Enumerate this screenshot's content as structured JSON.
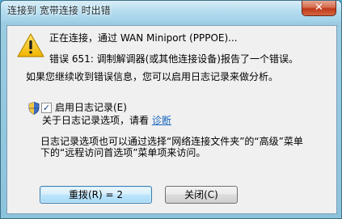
{
  "window": {
    "title": "连接到 宽带连接 时出错",
    "close_glyph": "✕"
  },
  "message": {
    "connecting": "正在连接，通过 WAN Miniport (PPPOE)...",
    "error": "错误 651: 调制解调器(或其他连接设备)报告了一个错误。",
    "hint": "如果您继续收到错误信息，您可以启用日志记录来做分析。"
  },
  "logging": {
    "enable_label": "启用日志记录(E)",
    "checked": true,
    "check_glyph": "✓",
    "about_prefix": "关于日志记录选项，请看",
    "about_link": "诊断",
    "desc_line1": "日志记录选项也可以通过选择“网络连接文件夹”的“高级”菜单",
    "desc_line2": "下的“远程访问首选项”菜单项来访问。"
  },
  "buttons": {
    "redial": "重拨(R) = 2",
    "close": "关闭(C)"
  },
  "colors": {
    "accent": "#3c7fb1",
    "link": "#1565c0",
    "warning": "#f2c31c"
  }
}
